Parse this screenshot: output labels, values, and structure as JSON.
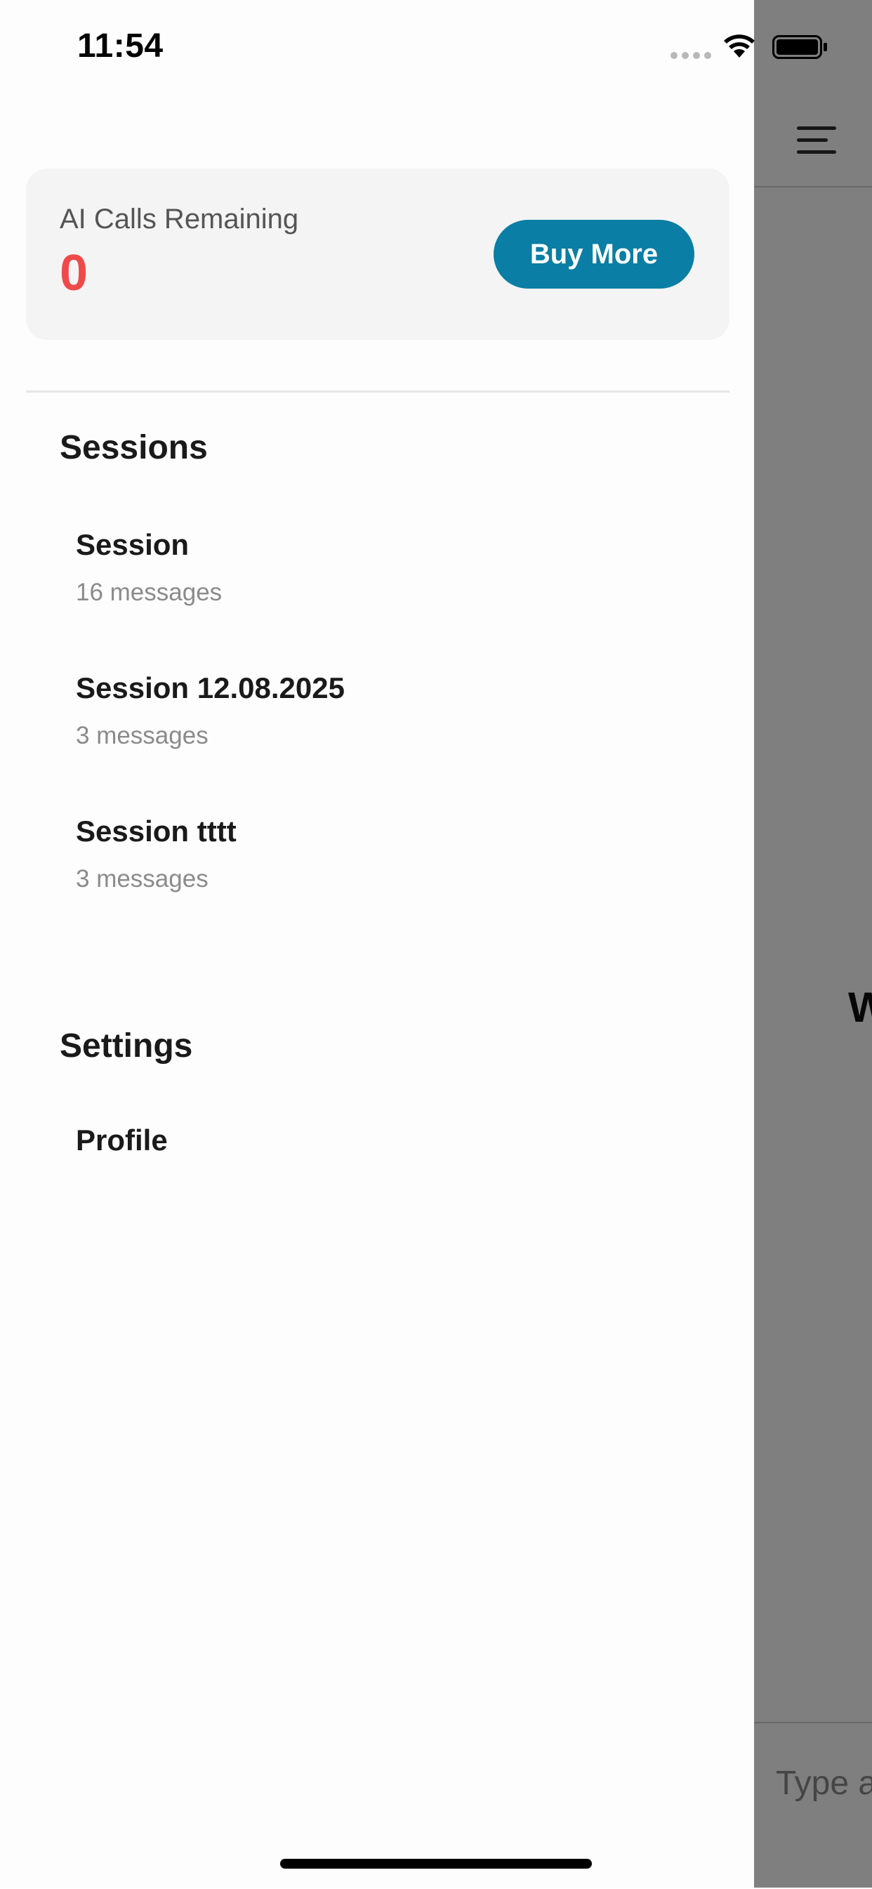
{
  "status_bar": {
    "time": "11:54"
  },
  "credits": {
    "label": "AI Calls Remaining",
    "value": "0",
    "buy_label": "Buy More"
  },
  "sessions": {
    "title": "Sessions",
    "items": [
      {
        "title": "Session",
        "subtitle": "16 messages"
      },
      {
        "title": "Session 12.08.2025",
        "subtitle": "3 messages"
      },
      {
        "title": "Session tttt",
        "subtitle": "3 messages"
      }
    ]
  },
  "settings": {
    "title": "Settings",
    "profile_label": "Profile"
  },
  "background": {
    "welcome_fragment": "W",
    "input_placeholder": "Type a"
  },
  "colors": {
    "accent": "#0a7ea4",
    "credits_value": "#ef4a4a",
    "overlay": "rgba(0,0,0,0.5)"
  },
  "icons": [
    "hamburger-menu-icon",
    "wifi-icon",
    "battery-icon",
    "cellular-signal-icon"
  ]
}
